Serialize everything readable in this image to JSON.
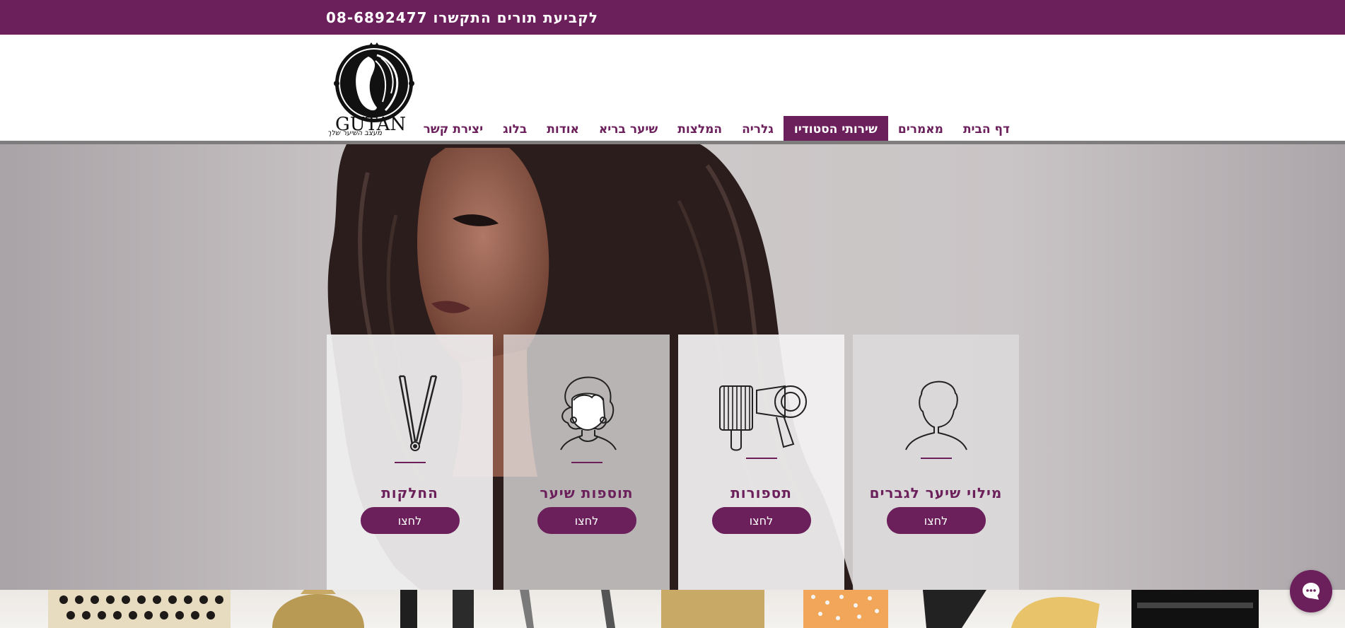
{
  "colors": {
    "brand": "#6b1f5b",
    "white": "#ffffff"
  },
  "topbar": {
    "text": "לקביעת תורים התקשרו  08-6892477"
  },
  "logo": {
    "name": "GUTAN",
    "tagline": "מעצב השיער שלך",
    "icon": "woman-silhouette-logo"
  },
  "nav": {
    "items": [
      {
        "label": "דף הבית",
        "active": false
      },
      {
        "label": "מאמרים",
        "active": false
      },
      {
        "label": "שירותי הסטודיו",
        "active": true
      },
      {
        "label": "גלריה",
        "active": false
      },
      {
        "label": "המלצות",
        "active": false
      },
      {
        "label": "שיער בריא",
        "active": false
      },
      {
        "label": "אודות",
        "active": false
      },
      {
        "label": "בלוג",
        "active": false
      },
      {
        "label": "יצירת קשר",
        "active": false
      }
    ]
  },
  "services": [
    {
      "title": "החלקות",
      "button": "לחצו",
      "icon": "hair-straightener-icon"
    },
    {
      "title": "תוספות שיער",
      "button": "לחצו",
      "icon": "woman-hair-extensions-icon"
    },
    {
      "title": "תספורות",
      "button": "לחצו",
      "icon": "brush-and-dryer-icon"
    },
    {
      "title": "מילוי שיער לגברים",
      "button": "לחצו",
      "icon": "man-head-icon"
    }
  ],
  "chat": {
    "icon": "chat-bubble-icon"
  }
}
